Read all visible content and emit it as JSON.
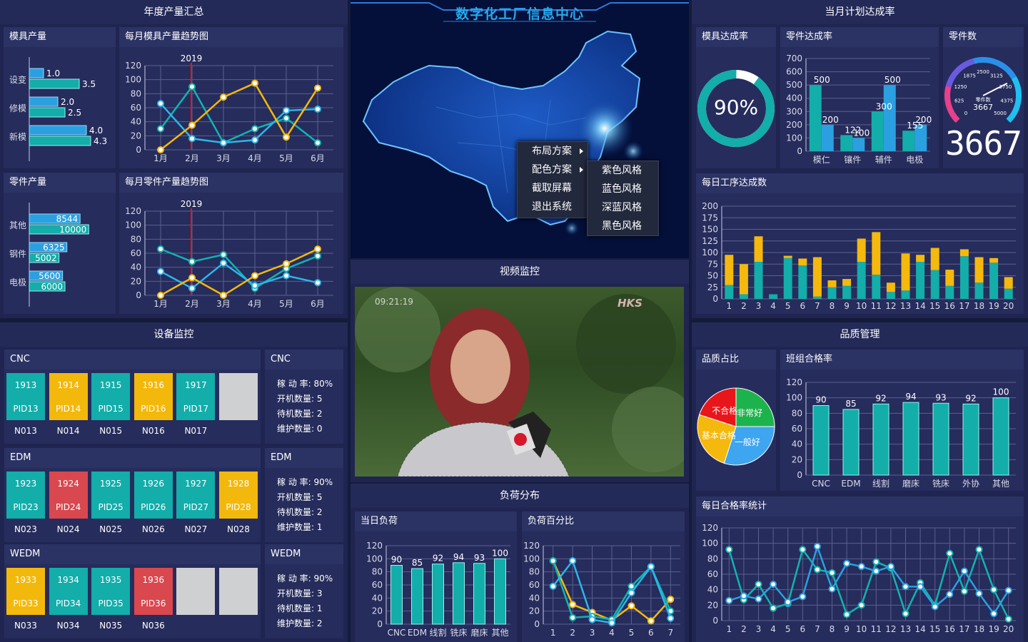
{
  "header": {
    "title": "数字化工厂信息中心"
  },
  "sections": {
    "annual": "年度产量汇总",
    "plan": "当月计划达成率",
    "video": "视频监控",
    "equipment": "设备监控",
    "quality": "品质管理",
    "load": "负荷分布"
  },
  "panels": {
    "mold_output": "模具产量",
    "mold_trend": "每月模具产量趋势图",
    "part_output": "零件产量",
    "part_trend": "每月零件产量趋势图",
    "mold_rate": "模具达成率",
    "part_rate": "零件达成率",
    "part_count": "零件数",
    "daily_proc": "每日工序达成数",
    "quality_ratio": "品质占比",
    "team_pass": "班组合格率",
    "daily_pass": "每日合格率统计",
    "today_load": "当日负荷",
    "load_pct": "负荷百分比"
  },
  "mold_bars": {
    "categories": [
      "设变",
      "修模",
      "新模"
    ],
    "a": [
      1.0,
      2.0,
      4.0
    ],
    "b": [
      3.5,
      2.5,
      4.3
    ],
    "max": 5
  },
  "part_bars": {
    "categories": [
      "其他",
      "钢件",
      "电极"
    ],
    "a": [
      8544,
      6325,
      5600
    ],
    "b": [
      10000,
      5002,
      6000
    ],
    "max": 12000
  },
  "mold_trend_chart": {
    "x": [
      "1月",
      "2月",
      "3月",
      "4月",
      "5月",
      "6月"
    ],
    "yticks": [
      0,
      20,
      40,
      60,
      80,
      100,
      120
    ],
    "marker_label": "2019",
    "series": [
      {
        "color": "#12b3b0",
        "values": [
          30,
          90,
          10,
          30,
          45,
          10
        ]
      },
      {
        "color": "#2bb6e9",
        "values": [
          66,
          16,
          10,
          14,
          56,
          58
        ]
      },
      {
        "color": "#f5b80c",
        "values": [
          0,
          35,
          75,
          95,
          18,
          88
        ]
      }
    ]
  },
  "part_trend_chart": {
    "x": [
      "1月",
      "2月",
      "3月",
      "4月",
      "5月",
      "6月"
    ],
    "yticks": [
      0,
      20,
      40,
      60,
      80,
      100,
      120
    ],
    "marker_label": "2019",
    "series": [
      {
        "color": "#12b3b0",
        "values": [
          66,
          48,
          58,
          10,
          38,
          56
        ]
      },
      {
        "color": "#2bb6e9",
        "values": [
          34,
          10,
          46,
          14,
          28,
          18
        ]
      },
      {
        "color": "#f5b80c",
        "values": [
          0,
          25,
          0,
          28,
          45,
          66
        ]
      }
    ]
  },
  "donut": {
    "value": 90,
    "label": "90%"
  },
  "part_rate_chart": {
    "categories": [
      "模仁",
      "镶件",
      "辅件",
      "电极"
    ],
    "yticks": [
      0,
      100,
      200,
      300,
      400,
      500,
      600,
      700
    ],
    "a": [
      500,
      122,
      300,
      155
    ],
    "b": [
      200,
      100,
      500,
      200
    ]
  },
  "gauge": {
    "ticks": [
      "0",
      "625",
      "1250",
      "1875",
      "2500",
      "3125",
      "3750",
      "4375",
      "5000"
    ],
    "center_label": "零件数",
    "center_value": "3667",
    "value": 3667,
    "display": "3667"
  },
  "daily_proc_chart": {
    "x": [
      "1",
      "2",
      "3",
      "4",
      "5",
      "6",
      "7",
      "8",
      "9",
      "10",
      "11",
      "12",
      "13",
      "14",
      "15",
      "16",
      "17",
      "18",
      "19",
      "20"
    ],
    "yticks": [
      0,
      25,
      50,
      75,
      100,
      125,
      150,
      175,
      200
    ],
    "a": [
      30,
      10,
      80,
      10,
      88,
      72,
      5,
      25,
      28,
      80,
      52,
      15,
      18,
      80,
      62,
      28,
      92,
      35,
      78,
      22
    ],
    "b": [
      65,
      65,
      55,
      0,
      5,
      15,
      85,
      15,
      15,
      50,
      92,
      20,
      80,
      15,
      48,
      35,
      15,
      55,
      10,
      25
    ]
  },
  "menu": {
    "items": [
      "布局方案",
      "配色方案",
      "截取屏幕",
      "退出系统"
    ],
    "sub": [
      "紫色风格",
      "蓝色风格",
      "深蓝风格",
      "黑色风格"
    ]
  },
  "video": {
    "timestamp": "09:21:19",
    "logo": "HKS"
  },
  "equipment": [
    {
      "name": "CNC",
      "ids": [
        "1913",
        "1914",
        "1915",
        "1916",
        "1917"
      ],
      "pids": [
        "PID13",
        "PID14",
        "PID15",
        "PID16",
        "PID17"
      ],
      "labels": [
        "N013",
        "N014",
        "N015",
        "N016",
        "N017"
      ],
      "colors": [
        "#13adaa",
        "#f3b80c",
        "#13adaa",
        "#f3b80c",
        "#13adaa",
        "#cfd0d2"
      ],
      "stats": [
        "稼 动 率: 80%",
        "开机数量: 5",
        "待机数量: 2",
        "维护数量: 0"
      ]
    },
    {
      "name": "EDM",
      "ids": [
        "1923",
        "1924",
        "1925",
        "1926",
        "1927",
        "1928"
      ],
      "pids": [
        "PID23",
        "PID24",
        "PID25",
        "PID26",
        "PID27",
        "PID28"
      ],
      "labels": [
        "N023",
        "N024",
        "N025",
        "N026",
        "N027",
        "N028"
      ],
      "colors": [
        "#13adaa",
        "#d9484e",
        "#13adaa",
        "#13adaa",
        "#13adaa",
        "#f3b80c"
      ],
      "stats": [
        "稼 动 率: 90%",
        "开机数量: 5",
        "待机数量: 2",
        "维护数量: 1"
      ]
    },
    {
      "name": "WEDM",
      "ids": [
        "1933",
        "1934",
        "1935",
        "1936"
      ],
      "pids": [
        "PID33",
        "PID34",
        "PID35",
        "PID36"
      ],
      "labels": [
        "N033",
        "N034",
        "N035",
        "N036"
      ],
      "colors": [
        "#f3b80c",
        "#13adaa",
        "#13adaa",
        "#d9484e",
        "#cfd0d2",
        "#cfd0d2"
      ],
      "stats": [
        "稼 动 率: 90%",
        "开机数量: 3",
        "待机数量: 1",
        "维护数量: 2"
      ]
    }
  ],
  "pie": {
    "labels": [
      "非常好",
      "一般好",
      "基本合格",
      "不合格"
    ],
    "colors": [
      "#1db34c",
      "#3ea5f0",
      "#f5b80c",
      "#e8161b"
    ],
    "values": [
      25,
      30,
      25,
      20
    ]
  },
  "team_pass_chart": {
    "categories": [
      "CNC",
      "EDM",
      "线割",
      "磨床",
      "铣床",
      "外协",
      "其他"
    ],
    "values": [
      90,
      85,
      92,
      94,
      93,
      92,
      100
    ],
    "yticks": [
      0,
      20,
      40,
      60,
      80,
      100,
      120
    ]
  },
  "daily_pass_chart": {
    "x": [
      "1",
      "2",
      "3",
      "4",
      "5",
      "6",
      "7",
      "8",
      "9",
      "10",
      "11",
      "12",
      "13",
      "14",
      "15",
      "16",
      "17",
      "18",
      "19",
      "20"
    ],
    "yticks": [
      0,
      20,
      40,
      60,
      80,
      100,
      120
    ],
    "a": [
      92,
      27,
      47,
      16,
      22,
      92,
      66,
      62,
      8,
      20,
      76,
      68,
      9,
      49,
      20,
      87,
      38,
      92,
      40,
      2
    ],
    "b": [
      26,
      32,
      28,
      47,
      24,
      31,
      96,
      41,
      74,
      70,
      64,
      70,
      44,
      44,
      18,
      34,
      64,
      35,
      9,
      39
    ]
  },
  "today_load_chart": {
    "categories": [
      "CNC",
      "EDM",
      "线割",
      "铣床",
      "磨床",
      "其他"
    ],
    "values": [
      90,
      85,
      92,
      94,
      93,
      100
    ],
    "labels": [
      "90",
      "85",
      "92",
      "94",
      "93",
      "100"
    ],
    "yticks": [
      0,
      20,
      40,
      60,
      80,
      100,
      120
    ]
  },
  "load_pct_chart": {
    "x": [
      "1",
      "2",
      "3",
      "4",
      "5",
      "6",
      "7"
    ],
    "yticks": [
      0,
      20,
      40,
      60,
      80,
      100,
      120
    ],
    "series": [
      {
        "color": "#f5b80c",
        "values": [
          97,
          30,
          18,
          6,
          28,
          5,
          38
        ]
      },
      {
        "color": "#12b3b0",
        "values": [
          97,
          10,
          12,
          7,
          58,
          88,
          20
        ]
      },
      {
        "color": "#2bb6e9",
        "values": [
          58,
          97,
          7,
          2,
          48,
          88,
          9
        ]
      }
    ]
  }
}
